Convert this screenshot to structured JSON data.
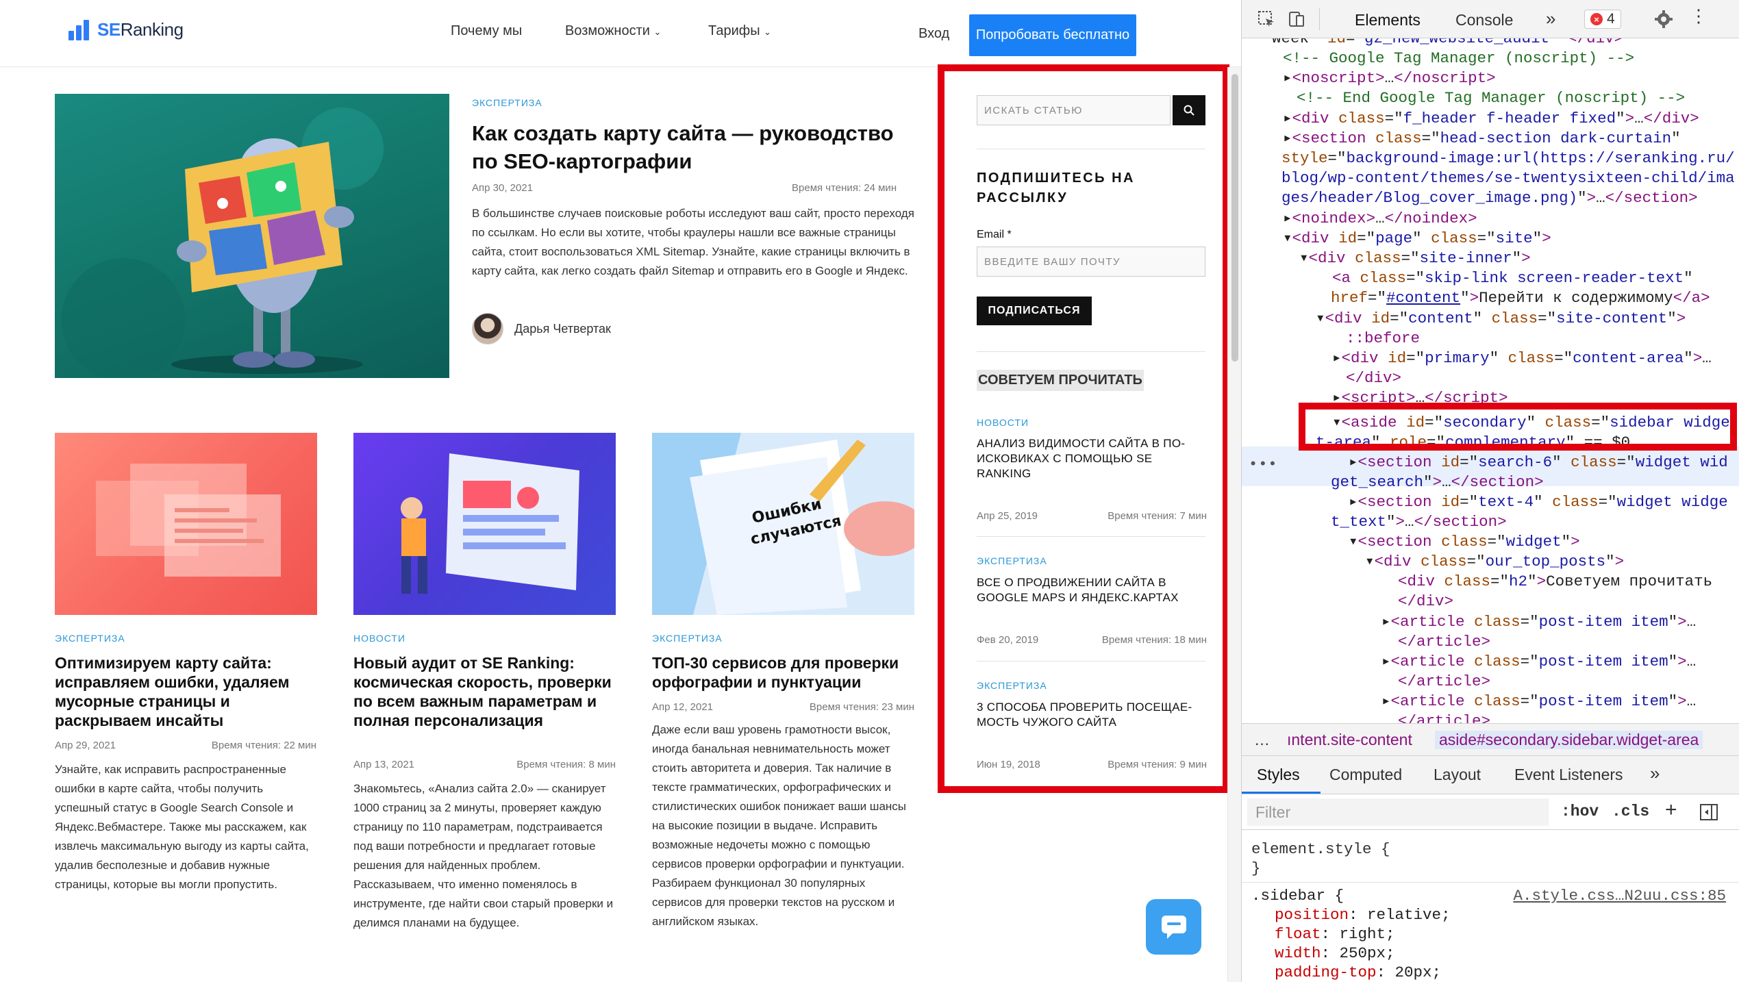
{
  "header": {
    "logo_text_brand": "SE",
    "logo_text_rest": "Ranking",
    "nav": [
      "Почему мы",
      "Возможности",
      "Тарифы"
    ],
    "login": "Вход",
    "try_button": "Попробовать бесплатно"
  },
  "featured": {
    "category": "ЭКСПЕРТИЗА",
    "title": "Как создать карту сайта — руководство по SEO-картографии",
    "date": "Апр 30, 2021",
    "read_time": "Время чтения: 24 мин",
    "excerpt": "В большинстве случаев поисковые роботы исследуют ваш сайт, просто переходя по ссылкам. Но если вы хотите, чтобы краулеры нашли все важные страницы сайта, стоит воспользоваться XML Sitemap. Узнайте, какие страницы включить в карту сайта, как легко создать файл Sitemap и отправить его в Google и Яндекс.",
    "author": "Дарья Четвертак"
  },
  "cards": [
    {
      "category": "ЭКСПЕРТИЗА",
      "title": "Оптимизируем карту сайта: исправляем ошибки, удаляем мусорные страницы и раскрываем инсайты",
      "date": "Апр 29, 2021",
      "read_time": "Время чтения: 22 мин",
      "excerpt": "Узнайте, как исправить распространенные ошибки в карте сайта, чтобы получить успешный статус в Google Search Console и Яндекс.Вебмастере. Также мы расскажем, как извлечь максимальную выгоду из карты сайта, удалив бесполезные и добавив нужные страницы, которые вы могли пропустить."
    },
    {
      "category": "НОВОСТИ",
      "title": "Новый аудит от SE Ranking: космическая скорость, проверки по всем важным параметрам и полная персонализация",
      "date": "Апр 13, 2021",
      "read_time": "Время чтения: 8 мин",
      "excerpt": "Знакомьтесь, «Анализ сайта 2.0» — сканирует 1000 страниц за 2 минуты, проверяет каждую страницу по 110 параметрам, подстраивается под ваши потребности и предлагает готовые решения для найденных проблем. Рассказываем, что именно поменялось в инструменте, где найти свои старый проверки и делимся планами на будущее."
    },
    {
      "category": "ЭКСПЕРТИЗА",
      "title": "ТОП-30 сервисов для проверки орфографии и пунктуации",
      "date": "Апр 12, 2021",
      "read_time": "Время чтения: 23 мин",
      "excerpt": "Даже если ваш уровень грамотности высок, иногда банальная невнимательность может стоить авторитета и доверия. Так наличие в тексте грамматических, орфографических и стилистических ошибок понижает ваши шансы на высокие позиции в выдаче. Исправить возможные недочеты можно с помощью сервисов проверки орфографии и пунктуации. Разбираем функционал 30 популярных сервисов для проверки текстов на русском и английском языках.",
      "image_text": "Ошибки случаются"
    }
  ],
  "sidebar": {
    "search_placeholder": "ИСКАТЬ СТАТЬЮ",
    "subscribe_title": "ПОДПИШИТЕСЬ НА РАССЫЛКУ",
    "email_label": "Email *",
    "email_placeholder": "ВВЕДИТЕ ВАШУ ПОЧТУ",
    "subscribe_button": "ПОДПИСАТЬСЯ",
    "recommended_title": "СОВЕТУЕМ ПРОЧИТАТЬ",
    "posts": [
      {
        "category": "НОВОСТИ",
        "title": "АНАЛИЗ ВИДИМОСТИ САЙТА В ПО-ИСКОВИКАХ С ПОМОЩЬЮ SE RANKING",
        "date": "Апр 25, 2019",
        "read_time": "Время чтения: 7 мин"
      },
      {
        "category": "ЭКСПЕРТИЗА",
        "title": "ВСЕ О ПРОДВИЖЕНИИ САЙТА В GOOGLE MAPS И ЯНДЕКС.КАРТАХ",
        "date": "Фев 20, 2019",
        "read_time": "Время чтения: 18 мин"
      },
      {
        "category": "ЭКСПЕРТИЗА",
        "title": "3 СПОСОБА ПРОВЕРИТЬ ПОСЕЩАЕ-МОСТЬ ЧУЖОГО САЙТА",
        "date": "Июн 19, 2018",
        "read_time": "Время чтения: 9 мин"
      }
    ]
  },
  "devtools": {
    "tabs": [
      "Elements",
      "Console"
    ],
    "error_count": "4",
    "breadcrumb": [
      "…",
      "ıntent.site-content",
      "aside#secondary.sidebar.widget-area"
    ],
    "styles_tabs": [
      "Styles",
      "Computed",
      "Layout",
      "Event Listeners"
    ],
    "filter_placeholder": "Filter",
    "hov": ":hov",
    "cls": ".cls",
    "element_style": "element.style {",
    "close_brace": "}",
    "sidebar_selector": ".sidebar {",
    "sidebar_source": "A.style.css…N2uu.css:85",
    "css_props": [
      {
        "name": "position",
        "value": "relative;"
      },
      {
        "name": "float",
        "value": "right;"
      },
      {
        "name": "width",
        "value": "250px;"
      },
      {
        "name": "padding-top",
        "value": "20px;"
      }
    ]
  },
  "colors": {
    "accent": "#1a80f6",
    "category": "#2a97d6",
    "highlight_box": "#e0000f",
    "devtools_selected": "#e8f0fe"
  }
}
